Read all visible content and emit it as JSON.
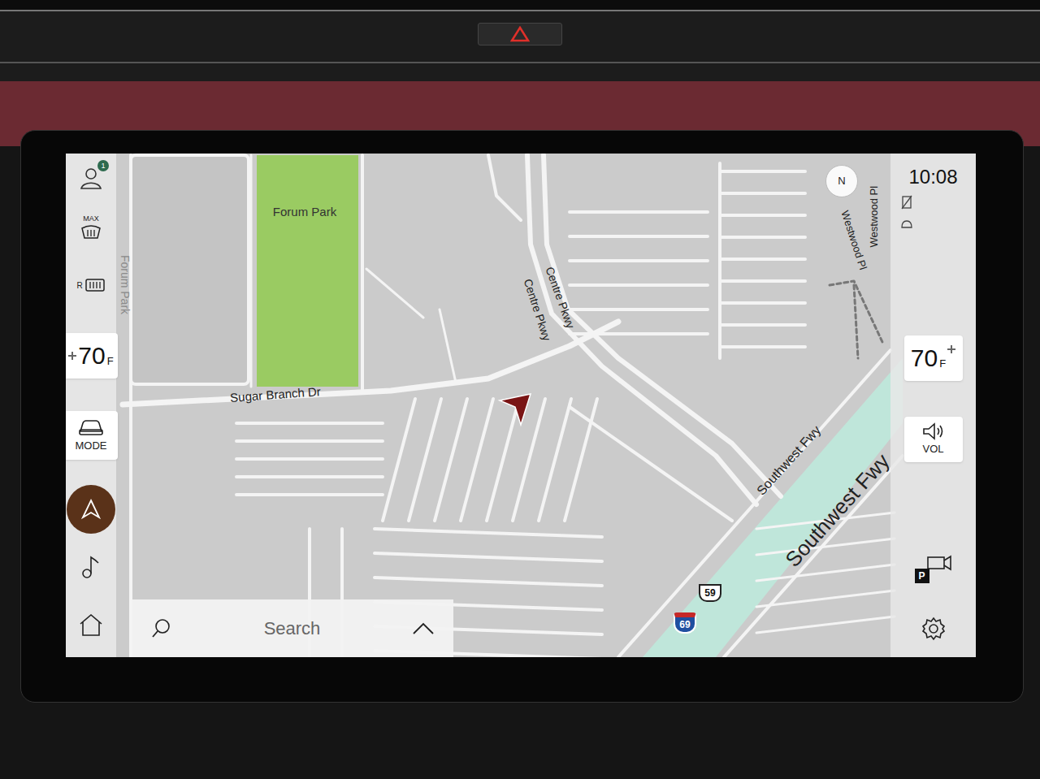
{
  "profile": {
    "badge": "1"
  },
  "climate": {
    "front_defrost": "MAX",
    "rear_defrost": "R",
    "left_temp": {
      "value": "70",
      "unit": "F"
    },
    "right_temp": {
      "value": "70",
      "unit": "F"
    }
  },
  "mode_button": "MODE",
  "nav_button": {
    "selected": true
  },
  "music_button": {
    "selected": false
  },
  "home_button": {
    "selected": false
  },
  "volume_button": "VOL",
  "camera_button": "P",
  "clock": "10:08",
  "compass": "N",
  "search": {
    "label": "Search"
  },
  "map": {
    "labels": [
      "Forum Park",
      "Forum Park",
      "Sugar Branch Dr",
      "Centre Pkwy",
      "Centre Pkwy",
      "Westwood Pl",
      "Westwood Pl",
      "Southwest Fwy",
      "Southwest Fwy"
    ],
    "shields": [
      {
        "text": "59",
        "kind": "us"
      },
      {
        "text": "69",
        "kind": "interstate"
      }
    ]
  }
}
